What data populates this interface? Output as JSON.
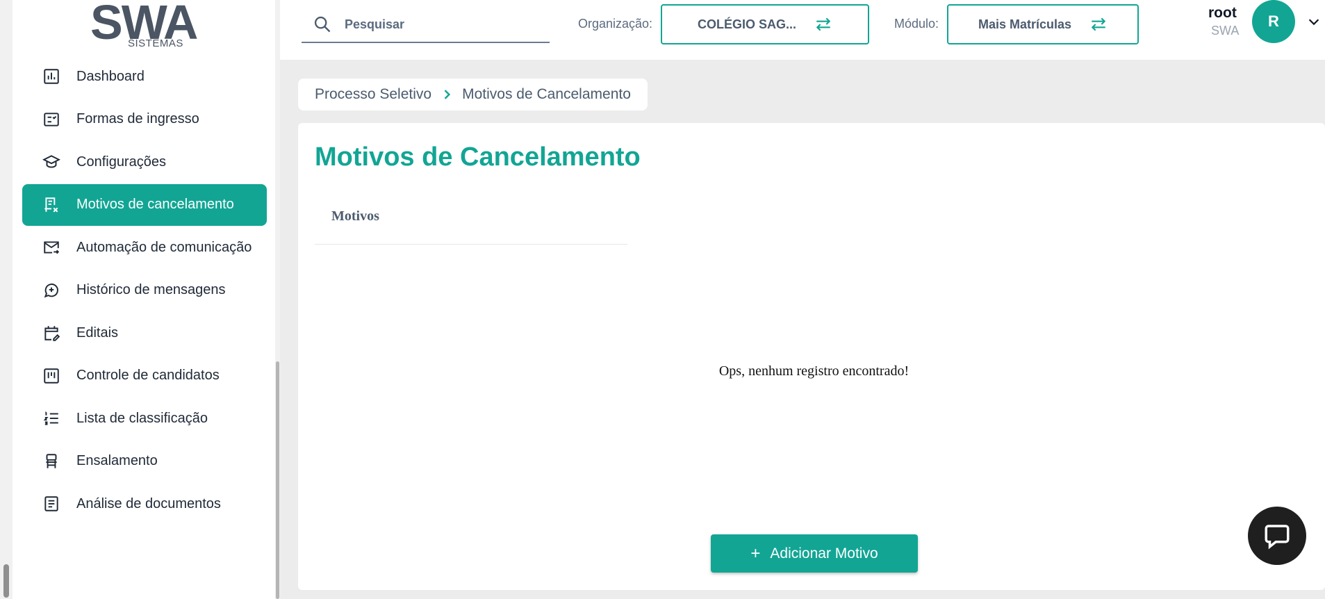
{
  "brand": {
    "logo_main": "SWA",
    "logo_sub": "SISTEMAS"
  },
  "search": {
    "placeholder": "Pesquisar"
  },
  "header": {
    "org_label": "Organização:",
    "org_value": "COLÉGIO SAG...",
    "module_label": "Módulo:",
    "module_value": "Mais Matrículas",
    "user_name": "root",
    "user_org": "SWA",
    "avatar_initial": "R"
  },
  "sidebar": {
    "items": [
      {
        "label": "Dashboard",
        "icon": "dashboard-icon"
      },
      {
        "label": "Formas de ingresso",
        "icon": "checklist-icon"
      },
      {
        "label": "Configurações",
        "icon": "graduation-cap-icon"
      },
      {
        "label": "Motivos de cancelamento",
        "icon": "receipt-cancel-icon",
        "active": true
      },
      {
        "label": "Automação de comunicação",
        "icon": "mail-forward-icon"
      },
      {
        "label": "Histórico de mensagens",
        "icon": "message-plus-icon"
      },
      {
        "label": "Editais",
        "icon": "calendar-edit-icon"
      },
      {
        "label": "Controle de candidatos",
        "icon": "kanban-icon"
      },
      {
        "label": "Lista de classificação",
        "icon": "ordered-list-icon"
      },
      {
        "label": "Ensalamento",
        "icon": "seat-icon"
      },
      {
        "label": "Análise de documentos",
        "icon": "document-icon"
      }
    ]
  },
  "breadcrumb": {
    "parent": "Processo Seletivo",
    "current": "Motivos de Cancelamento"
  },
  "main": {
    "title": "Motivos de Cancelamento",
    "column_header": "Motivos",
    "empty_message": "Ops, nenhum registro encontrado!",
    "add_button": "Adicionar Motivo",
    "add_button_icon": "+"
  },
  "colors": {
    "accent": "#12a594",
    "text": "#1f2937",
    "muted": "#5b6b7f",
    "background": "#ececec"
  }
}
